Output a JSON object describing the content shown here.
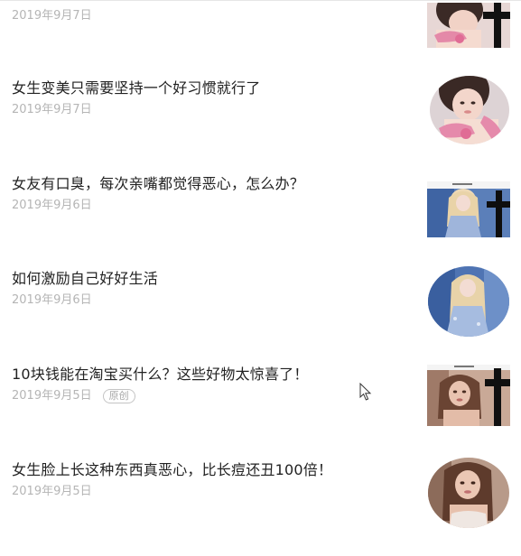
{
  "articles": [
    {
      "title": "",
      "date": "2019年9月7日",
      "thumbnail": "woman-with-pink-phone-cross"
    },
    {
      "title": "女生变美只需要坚持一个好习惯就行了",
      "date": "2019年9月7日",
      "thumbnail": "woman-with-pink-phone"
    },
    {
      "title": "女友有口臭，每次亲嘴都觉得恶心，怎么办？",
      "date": "2019年9月6日",
      "thumbnail": "blonde-woman-blue-dress-cross"
    },
    {
      "title": "如何激励自己好好生活",
      "date": "2019年9月6日",
      "thumbnail": "blonde-woman-blue-dress"
    },
    {
      "title": "10块钱能在淘宝买什么？这些好物太惊喜了！",
      "date": "2019年9月5日",
      "badge": "原创",
      "thumbnail": "brunette-woman-cross"
    },
    {
      "title": "女生脸上长这种东西真恶心，比长痘还丑100倍！",
      "date": "2019年9月5日",
      "thumbnail": "brunette-woman"
    }
  ],
  "colors": {
    "title_text": "#222222",
    "date_text": "#b5b5b5",
    "badge_border": "#c4c4c4",
    "background": "#ffffff"
  },
  "icons": {
    "cursor": "arrow-cursor-icon",
    "cross": "cross-icon"
  }
}
